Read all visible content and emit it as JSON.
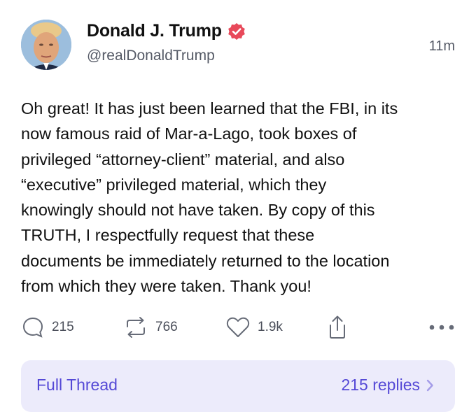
{
  "post": {
    "author": {
      "display_name": "Donald J. Trump",
      "handle": "@realDonaldTrump",
      "verified": true
    },
    "timestamp": "11m",
    "text": "Oh great! It has just been learned that the FBI, in its\nnow famous raid of Mar-a-Lago, took boxes of\nprivileged “attorney-client” material, and also\n“executive” privileged material, which they\nknowingly should not have taken. By copy of this\nTRUTH, I respectfully request that these\ndocuments be immediately returned to the location\nfrom which they were taken. Thank you!",
    "actions": {
      "replies": "215",
      "retruths": "766",
      "likes": "1.9k"
    },
    "thread": {
      "label": "Full Thread",
      "replies_label": "215 replies"
    }
  },
  "colors": {
    "accent": "#5448d6",
    "thread_bg": "#ecebfb",
    "verified_badge": "#e8495a",
    "muted_text": "#555a66"
  },
  "icons": [
    "reply-icon",
    "retruth-icon",
    "like-icon",
    "share-icon",
    "more-icon",
    "verified-badge-icon",
    "chevron-right-icon"
  ]
}
